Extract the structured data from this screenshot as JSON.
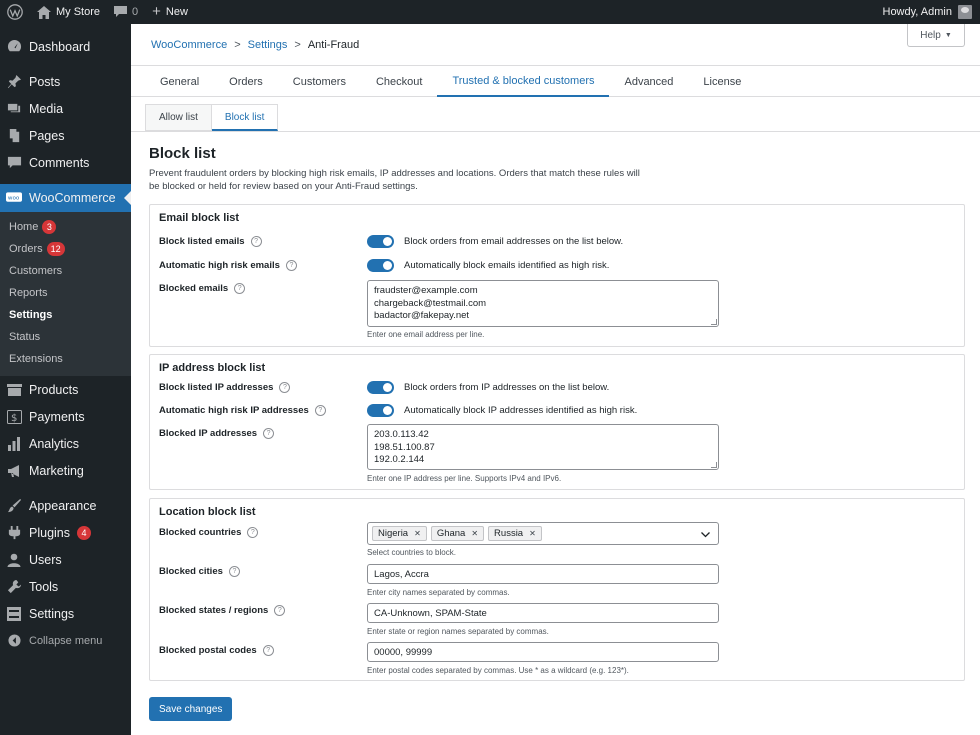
{
  "adminbar": {
    "site_name": "My Store",
    "comments_count": "0",
    "new_label": "New",
    "greeting": "Howdy, Admin"
  },
  "sidebar": {
    "dashboard": "Dashboard",
    "posts": "Posts",
    "media": "Media",
    "pages": "Pages",
    "comments": "Comments",
    "woocommerce": "WooCommerce",
    "woo_sub": [
      {
        "label": "Home",
        "badge": "3"
      },
      {
        "label": "Orders",
        "badge": "12"
      },
      {
        "label": "Customers"
      },
      {
        "label": "Reports"
      },
      {
        "label": "Settings"
      },
      {
        "label": "Status"
      },
      {
        "label": "Extensions"
      }
    ],
    "products": "Products",
    "payments": "Payments",
    "analytics": "Analytics",
    "marketing": "Marketing",
    "appearance": "Appearance",
    "plugins": "Plugins",
    "plugins_badge": "4",
    "users": "Users",
    "tools": "Tools",
    "settings": "Settings",
    "collapse": "Collapse menu"
  },
  "header": {
    "breadcrumb": [
      "WooCommerce",
      "Settings",
      "Anti-Fraud"
    ],
    "help": "Help"
  },
  "tabs": [
    "General",
    "Orders",
    "Customers",
    "Checkout",
    "Trusted & blocked customers",
    "Advanced",
    "License"
  ],
  "subtabs": [
    "Allow list",
    "Block list"
  ],
  "page": {
    "title": "Block list",
    "description": "Prevent fraudulent orders by blocking high risk emails, IP addresses and locations. Orders that match these rules will be blocked or held for review based on your Anti-Fraud settings."
  },
  "email_section": {
    "title": "Email block list",
    "block_listed_label": "Block listed emails",
    "block_listed_desc": "Block orders from email addresses on the list below.",
    "auto_label": "Automatic high risk emails",
    "auto_desc": "Automatically block emails identified as high risk.",
    "blocked_label": "Blocked emails",
    "blocked_values": [
      "fraudster@example.com",
      "chargeback@testmail.com",
      "badactor@fakepay.net"
    ],
    "hint": "Enter one email address per line."
  },
  "ip_section": {
    "title": "IP address block list",
    "block_listed_label": "Block listed IP addresses",
    "block_listed_desc": "Block orders from IP addresses on the list below.",
    "auto_label": "Automatic high risk IP addresses",
    "auto_desc": "Automatically block IP addresses identified as high risk.",
    "blocked_label": "Blocked IP addresses",
    "blocked_values": [
      "203.0.113.42",
      "198.51.100.87",
      "192.0.2.144"
    ],
    "hint": "Enter one IP address per line. Supports IPv4 and IPv6."
  },
  "location_section": {
    "title": "Location block list",
    "countries_label": "Blocked countries",
    "countries": [
      "Nigeria",
      "Ghana",
      "Russia"
    ],
    "countries_hint": "Select countries to block.",
    "cities_label": "Blocked cities",
    "cities_value": "Lagos, Accra",
    "cities_hint": "Enter city names separated by commas.",
    "states_label": "Blocked states / regions",
    "states_value": "CA-Unknown, SPAM-State",
    "states_hint": "Enter state or region names separated by commas.",
    "postal_label": "Blocked postal codes",
    "postal_value": "00000, 99999",
    "postal_hint": "Enter postal codes separated by commas. Use * as a wildcard (e.g. 123*)."
  },
  "save_label": "Save changes",
  "colors": {
    "accent": "#2271b1",
    "sidebar_bg": "#1d2327",
    "badge": "#d63638"
  }
}
